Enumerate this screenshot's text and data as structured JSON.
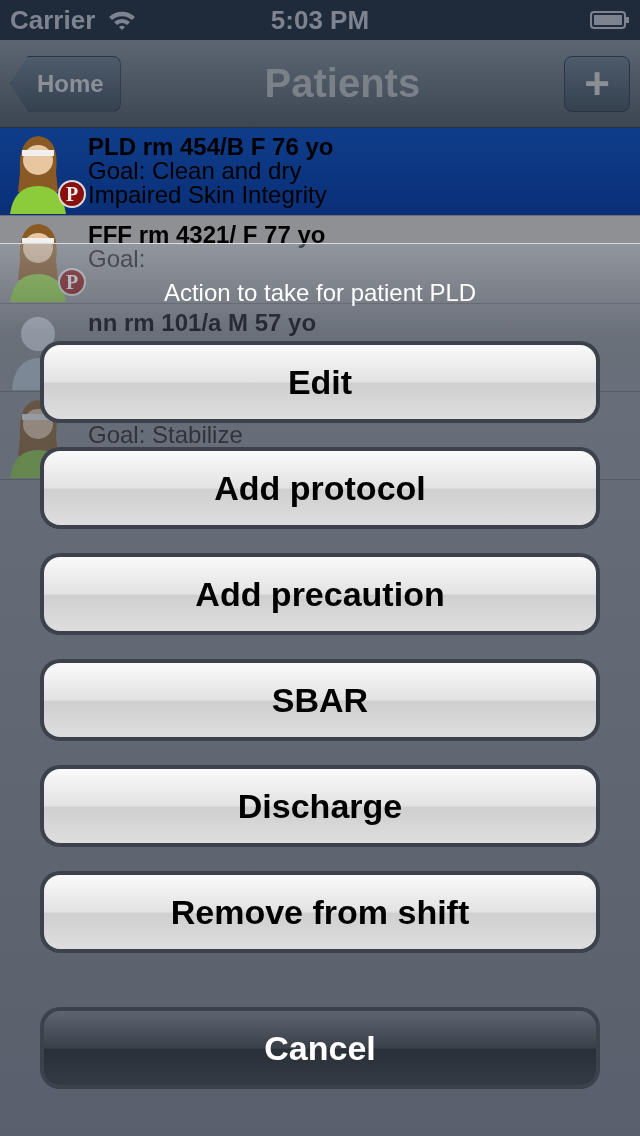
{
  "status_bar": {
    "carrier": "Carrier",
    "time": "5:03 PM"
  },
  "nav": {
    "back": "Home",
    "title": "Patients",
    "add": "+"
  },
  "patients": [
    {
      "name": "PLD rm 454/B F 76 yo",
      "goal": "Goal: Clean and dry",
      "diagnosis": "Impaired Skin Integrity",
      "badge": "P",
      "kind": "female",
      "selected": true
    },
    {
      "name": "FFF rm 4321/ F 77 yo",
      "goal": "Goal:",
      "badge": "P",
      "kind": "female",
      "selected": false
    },
    {
      "name": "nn rm 101/a M 57 yo",
      "kind": "male",
      "selected": false
    },
    {
      "goal": "Goal: Stabilize",
      "kind": "female",
      "selected": false
    }
  ],
  "sheet": {
    "title": "Action to take for patient PLD",
    "buttons": [
      {
        "label": "Edit",
        "kind": "default"
      },
      {
        "label": "Add protocol",
        "kind": "default"
      },
      {
        "label": "Add precaution",
        "kind": "default"
      },
      {
        "label": "SBAR",
        "kind": "default"
      },
      {
        "label": "Discharge",
        "kind": "default"
      },
      {
        "label": "Remove from shift",
        "kind": "default"
      },
      {
        "label": "Cancel",
        "kind": "cancel"
      }
    ]
  }
}
